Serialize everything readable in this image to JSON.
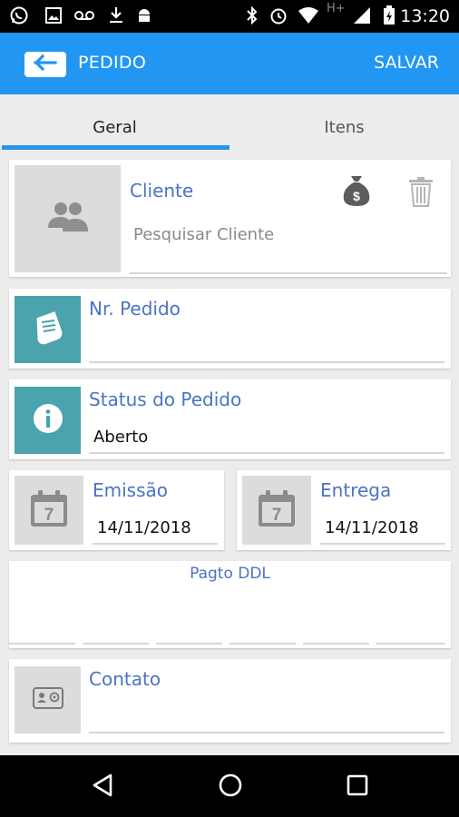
{
  "status_bar": {
    "time": "13:20",
    "network": "H+",
    "icons": [
      "whatsapp-icon",
      "image-icon",
      "voicemail-icon",
      "download-icon",
      "android-icon",
      "bluetooth-icon",
      "alarm-icon",
      "wifi-icon",
      "signal-icon",
      "battery-icon"
    ]
  },
  "app_bar": {
    "title": "PEDIDO",
    "save_label": "SALVAR",
    "back_icon": "arrow-left-icon",
    "color": "#2196f3"
  },
  "tabs": [
    {
      "label": "Geral",
      "active": true
    },
    {
      "label": "Itens",
      "active": false
    }
  ],
  "cliente": {
    "label": "Cliente",
    "placeholder": "Pesquisar Cliente",
    "icons": [
      "people-icon",
      "money-bag-icon",
      "trash-icon"
    ]
  },
  "nr_pedido": {
    "label": "Nr. Pedido",
    "value": "",
    "icon": "receipt-icon"
  },
  "status": {
    "label": "Status do Pedido",
    "value": "Aberto",
    "icon": "info-icon"
  },
  "emissao": {
    "label": "Emissão",
    "value": "14/11/2018",
    "icon_day": "7"
  },
  "entrega": {
    "label": "Entrega",
    "value": "14/11/2018",
    "icon_day": "7"
  },
  "pagto": {
    "label": "Pagto DDL",
    "fields": [
      "",
      "",
      "",
      "",
      "",
      ""
    ]
  },
  "contato": {
    "label": "Contato",
    "value": "",
    "icon": "contact-card-icon"
  },
  "colors": {
    "accent": "#2196f3",
    "label_blue": "#4b73c4",
    "teal": "#4aa3ad"
  }
}
